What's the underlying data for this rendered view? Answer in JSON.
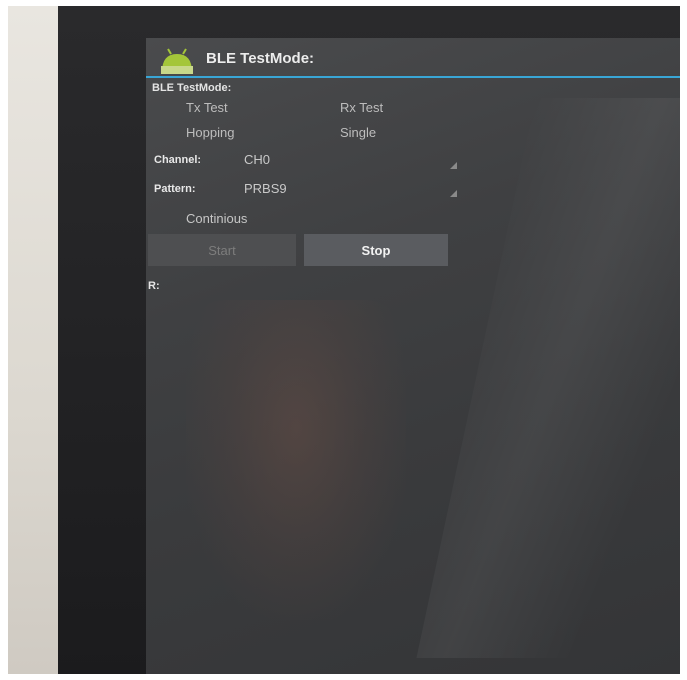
{
  "app": {
    "title": "BLE TestMode:",
    "icon": "android-robot-icon",
    "accent_color": "#39a6d6"
  },
  "form": {
    "section_title": "BLE TestMode:",
    "mode_options": [
      "Tx Test",
      "Rx Test"
    ],
    "hop_options": [
      "Hopping",
      "Single"
    ],
    "channel": {
      "label": "Channel:",
      "value": "CH0"
    },
    "pattern": {
      "label": "Pattern:",
      "value": "PRBS9"
    },
    "continuous_label": "Continious",
    "start_label": "Start",
    "stop_label": "Stop",
    "result_label": "R:",
    "result_value": ""
  }
}
